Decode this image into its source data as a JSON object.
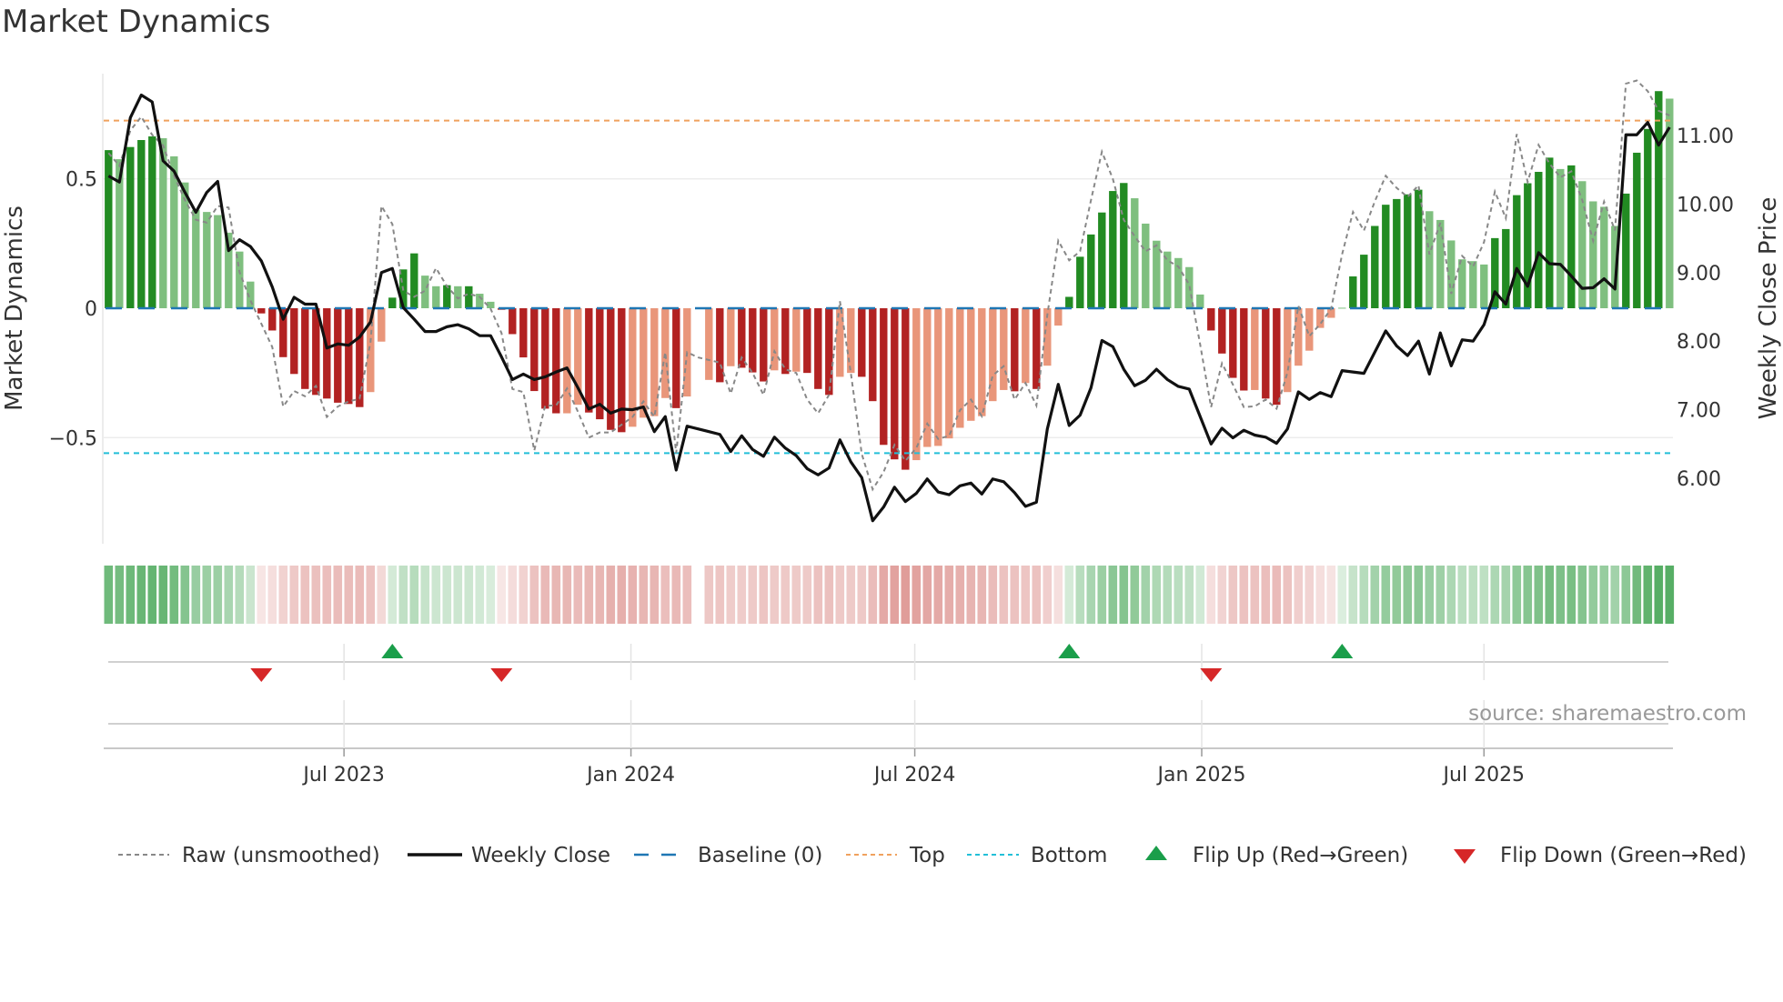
{
  "title": "Market Dynamics",
  "source": "source: sharemaestro.com",
  "colors": {
    "strong_green": "#228b22",
    "weak_green": "#7fbf7f",
    "strong_red": "#b22222",
    "weak_red": "#e9967a",
    "price": "#111111",
    "raw": "#888888",
    "baseline": "#1f77b4",
    "top": "#f0a15e",
    "bottom": "#22bfd8",
    "flip_up": "#1a9e4a",
    "flip_down": "#d62728",
    "strip_green": "#3aa04a",
    "strip_red": "#c8504a"
  },
  "legend": [
    {
      "label": "Raw (unsmoothed)",
      "icon": "dotted-gray-line"
    },
    {
      "label": "Weekly Close",
      "icon": "solid-black-line"
    },
    {
      "label": "Baseline (0)",
      "icon": "dashed-blue-line"
    },
    {
      "label": "Top",
      "icon": "dotted-orange-line"
    },
    {
      "label": "Bottom",
      "icon": "dotted-cyan-line"
    },
    {
      "label": "Flip Up (Red→Green)",
      "icon": "triangle-up"
    },
    {
      "label": "Flip Down (Green→Red)",
      "icon": "triangle-down"
    }
  ],
  "chart_data": {
    "type": "bar",
    "title": "Market Dynamics",
    "ylabel": "Market Dynamics",
    "y2label": "Weekly Close Price",
    "xlabel": "",
    "start_date": "2023-01-31",
    "interval_days": 7,
    "ylim": [
      -0.91,
      0.91
    ],
    "y2lim": [
      5.05,
      11.9
    ],
    "yticks": [
      {
        "value": 0.5,
        "label": "0.5"
      },
      {
        "value": 0,
        "label": "0"
      },
      {
        "value": -0.5,
        "label": "−0.5"
      }
    ],
    "y2ticks": [
      {
        "value": 6,
        "label": "6.00"
      },
      {
        "value": 7,
        "label": "7.00"
      },
      {
        "value": 8,
        "label": "8.00"
      },
      {
        "value": 9,
        "label": "9.00"
      },
      {
        "value": 10,
        "label": "10.00"
      },
      {
        "value": 11,
        "label": "11.00"
      }
    ],
    "xticks": [
      {
        "date": "2023-07-01",
        "label": "Jul 2023"
      },
      {
        "date": "2024-01-01",
        "label": "Jan 2024"
      },
      {
        "date": "2024-07-01",
        "label": "Jul 2024"
      },
      {
        "date": "2025-01-01",
        "label": "Jan 2025"
      },
      {
        "date": "2025-07-01",
        "label": "Jul 2025"
      }
    ],
    "baseline": 0,
    "top": 0.725,
    "bottom": -0.56,
    "grid": true,
    "legend_position": "bottom",
    "bar_shades": "GgGGGgggggggggRRRRRRRRRRrrGGGggGgGggRRRRRRrrRRRRrrrrRr_rRrRRRrRrRRRrrRRRRRrrrrrrrrrRrRrrGGGGGGgggggggRRRRrRRrrrrrgGGGGGGGggggggGGGGGGgGggggGGGGg",
    "series": [
      {
        "name": "Market Dynamics (smoothed)",
        "type": "bar",
        "values": [
          0.611,
          0.576,
          0.623,
          0.65,
          0.664,
          0.657,
          0.587,
          0.486,
          0.38,
          0.372,
          0.36,
          0.292,
          0.219,
          0.103,
          -0.02,
          -0.086,
          -0.189,
          -0.254,
          -0.312,
          -0.335,
          -0.349,
          -0.365,
          -0.37,
          -0.382,
          -0.324,
          -0.129,
          0.041,
          0.15,
          0.212,
          0.126,
          0.085,
          0.089,
          0.085,
          0.085,
          0.056,
          0.025,
          -0.006,
          -0.1,
          -0.19,
          -0.32,
          -0.388,
          -0.406,
          -0.406,
          -0.373,
          -0.403,
          -0.429,
          -0.47,
          -0.479,
          -0.458,
          -0.423,
          -0.417,
          -0.347,
          -0.386,
          -0.341,
          null,
          -0.277,
          -0.286,
          -0.224,
          -0.23,
          -0.248,
          -0.283,
          -0.24,
          -0.254,
          -0.245,
          -0.25,
          -0.312,
          -0.335,
          -0.265,
          -0.25,
          -0.265,
          -0.359,
          -0.528,
          -0.584,
          -0.624,
          -0.587,
          -0.536,
          -0.532,
          -0.503,
          -0.462,
          -0.435,
          -0.417,
          -0.359,
          -0.316,
          -0.321,
          -0.289,
          -0.312,
          -0.222,
          -0.067,
          0.044,
          0.199,
          0.285,
          0.37,
          0.453,
          0.484,
          0.425,
          0.327,
          0.261,
          0.219,
          0.194,
          0.159,
          0.053,
          -0.086,
          -0.175,
          -0.269,
          -0.318,
          -0.316,
          -0.349,
          -0.373,
          -0.324,
          -0.222,
          -0.164,
          -0.076,
          -0.037,
          0.002,
          0.123,
          0.207,
          0.318,
          0.4,
          0.422,
          0.44,
          0.458,
          0.375,
          0.341,
          0.262,
          0.189,
          0.182,
          0.169,
          0.271,
          0.306,
          0.437,
          0.483,
          0.527,
          0.582,
          0.538,
          0.552,
          0.491,
          0.413,
          0.392,
          0.318,
          0.443,
          0.601,
          0.693,
          0.839,
          0.81
        ]
      },
      {
        "name": "Raw (unsmoothed)",
        "type": "line",
        "values": [
          0.6,
          0.55,
          0.687,
          0.74,
          0.67,
          0.629,
          0.512,
          0.418,
          0.342,
          0.331,
          0.395,
          0.389,
          0.14,
          0.03,
          -0.06,
          -0.15,
          -0.38,
          -0.32,
          -0.34,
          -0.3,
          -0.42,
          -0.38,
          -0.36,
          -0.35,
          -0.13,
          0.395,
          0.325,
          0.068,
          0.044,
          0.068,
          0.155,
          0.085,
          0.038,
          0.056,
          0.044,
          -0.002,
          -0.096,
          -0.312,
          -0.324,
          -0.55,
          -0.376,
          -0.376,
          -0.31,
          -0.4,
          -0.5,
          -0.48,
          -0.48,
          -0.45,
          -0.42,
          -0.36,
          -0.42,
          -0.17,
          -0.56,
          -0.17,
          -0.19,
          -0.2,
          -0.21,
          -0.33,
          -0.19,
          -0.25,
          -0.335,
          -0.166,
          -0.236,
          -0.25,
          -0.353,
          -0.406,
          -0.335,
          0.027,
          -0.25,
          -0.563,
          -0.7,
          -0.633,
          -0.528,
          -0.59,
          -0.54,
          -0.446,
          -0.505,
          -0.493,
          -0.394,
          -0.353,
          -0.417,
          -0.26,
          -0.224,
          -0.353,
          -0.289,
          -0.376,
          -0.026,
          0.261,
          0.185,
          0.22,
          0.418,
          0.605,
          0.5,
          0.342,
          0.278,
          0.22,
          0.243,
          0.185,
          0.161,
          0.091,
          -0.14,
          -0.382,
          -0.213,
          -0.295,
          -0.382,
          -0.379,
          -0.353,
          -0.388,
          -0.248,
          0.009,
          -0.108,
          -0.061,
          -0.002,
          0.208,
          0.372,
          0.3,
          0.413,
          0.512,
          0.465,
          0.43,
          0.475,
          0.208,
          0.33,
          0.056,
          0.202,
          0.161,
          0.255,
          0.451,
          0.348,
          0.673,
          0.488,
          0.631,
          0.559,
          0.506,
          0.529,
          0.418,
          0.26,
          0.412,
          0.301,
          0.868,
          0.88,
          0.839,
          0.763,
          0.745
        ]
      },
      {
        "name": "Weekly Close",
        "type": "line",
        "axis": "right",
        "values": [
          10.41,
          10.32,
          11.26,
          11.59,
          11.49,
          10.63,
          10.48,
          10.17,
          9.88,
          10.17,
          10.33,
          9.32,
          9.48,
          9.38,
          9.17,
          8.79,
          8.32,
          8.64,
          8.54,
          8.54,
          7.9,
          7.96,
          7.94,
          8.06,
          8.28,
          9.0,
          9.06,
          8.49,
          8.32,
          8.14,
          8.14,
          8.21,
          8.24,
          8.18,
          8.08,
          8.08,
          7.77,
          7.44,
          7.52,
          7.44,
          7.48,
          7.55,
          7.61,
          7.32,
          7.01,
          7.08,
          6.95,
          7.01,
          7.0,
          7.04,
          6.68,
          6.9,
          6.12,
          6.76,
          6.72,
          6.68,
          6.64,
          6.39,
          6.62,
          6.42,
          6.32,
          6.6,
          6.44,
          6.33,
          6.14,
          6.05,
          6.15,
          6.56,
          6.24,
          6.01,
          5.38,
          5.58,
          5.87,
          5.66,
          5.78,
          5.99,
          5.8,
          5.76,
          5.89,
          5.93,
          5.77,
          5.99,
          5.95,
          5.79,
          5.59,
          5.65,
          6.72,
          7.37,
          6.77,
          6.92,
          7.32,
          8.01,
          7.92,
          7.59,
          7.35,
          7.43,
          7.59,
          7.44,
          7.34,
          7.3,
          6.9,
          6.5,
          6.73,
          6.59,
          6.7,
          6.63,
          6.6,
          6.51,
          6.72,
          7.26,
          7.15,
          7.25,
          7.19,
          7.57,
          7.55,
          7.53,
          7.84,
          8.15,
          7.93,
          7.79,
          8.0,
          7.52,
          8.12,
          7.64,
          8.02,
          8.0,
          8.24,
          8.72,
          8.54,
          9.06,
          8.8,
          9.29,
          9.13,
          9.12,
          8.95,
          8.77,
          8.78,
          8.91,
          8.76,
          11.01,
          11.01,
          11.19,
          10.86,
          11.12
        ]
      }
    ],
    "flips_up": [
      "2023-08-01",
      "2024-10-08",
      "2025-04-01"
    ],
    "flips_down": [
      "2023-05-09",
      "2023-10-10",
      "2025-01-07"
    ]
  }
}
